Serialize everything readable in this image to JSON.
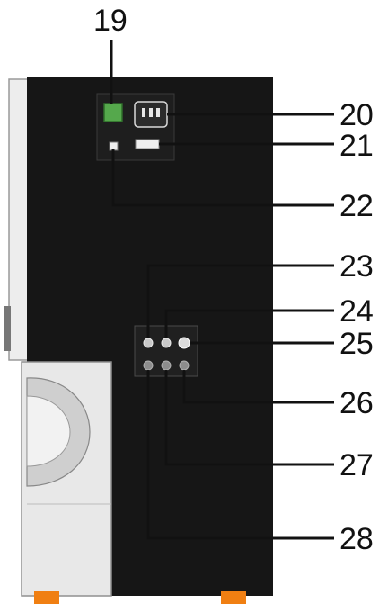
{
  "title": "",
  "colors": {
    "body": "#161616",
    "panel": "#e9e9e9",
    "panel_edge": "#bdbdbd",
    "feet": "#f07f12",
    "green_switch": "#55a84c",
    "leader": "#111111"
  },
  "callouts": [
    {
      "label": "19",
      "part": "green-power-switch"
    },
    {
      "label": "20",
      "part": "power-socket"
    },
    {
      "label": "21",
      "part": "fuse-holder"
    },
    {
      "label": "22",
      "part": "small-port"
    },
    {
      "label": "23",
      "part": "jack-top-left"
    },
    {
      "label": "24",
      "part": "jack-top-middle"
    },
    {
      "label": "25",
      "part": "jack-top-right"
    },
    {
      "label": "26",
      "part": "jack-bottom-right"
    },
    {
      "label": "27",
      "part": "jack-bottom-middle"
    },
    {
      "label": "28",
      "part": "jack-bottom-left"
    }
  ]
}
